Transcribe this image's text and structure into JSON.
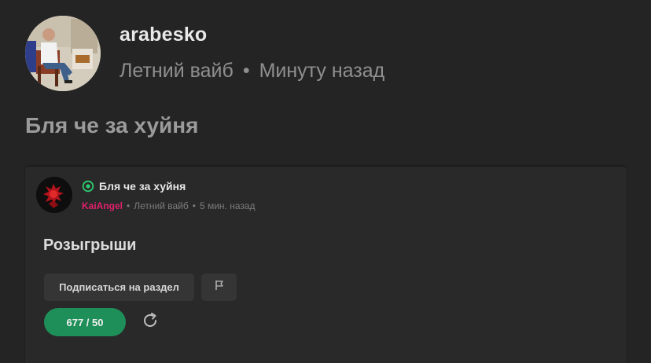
{
  "post": {
    "username": "arabesko",
    "category": "Летний вайб",
    "separator": "•",
    "time": "Минуту назад",
    "title": "Бля че за хуйня"
  },
  "embed": {
    "title": "Бля че за хуйня",
    "author": "KaiAngel",
    "category": "Летний вайб",
    "separator": "•",
    "time": "5 мин. назад",
    "section_heading": "Розыгрыши",
    "subscribe_label": "Подписаться на раздел",
    "counter_label": "677 / 50",
    "status_icon": "target-icon",
    "flag_icon": "flag-icon",
    "refresh_icon": "refresh-icon"
  },
  "colors": {
    "background": "#242424",
    "card": "#292929",
    "author": "#e0206c",
    "counter": "#1f8f5a",
    "status": "#2ecc71"
  }
}
